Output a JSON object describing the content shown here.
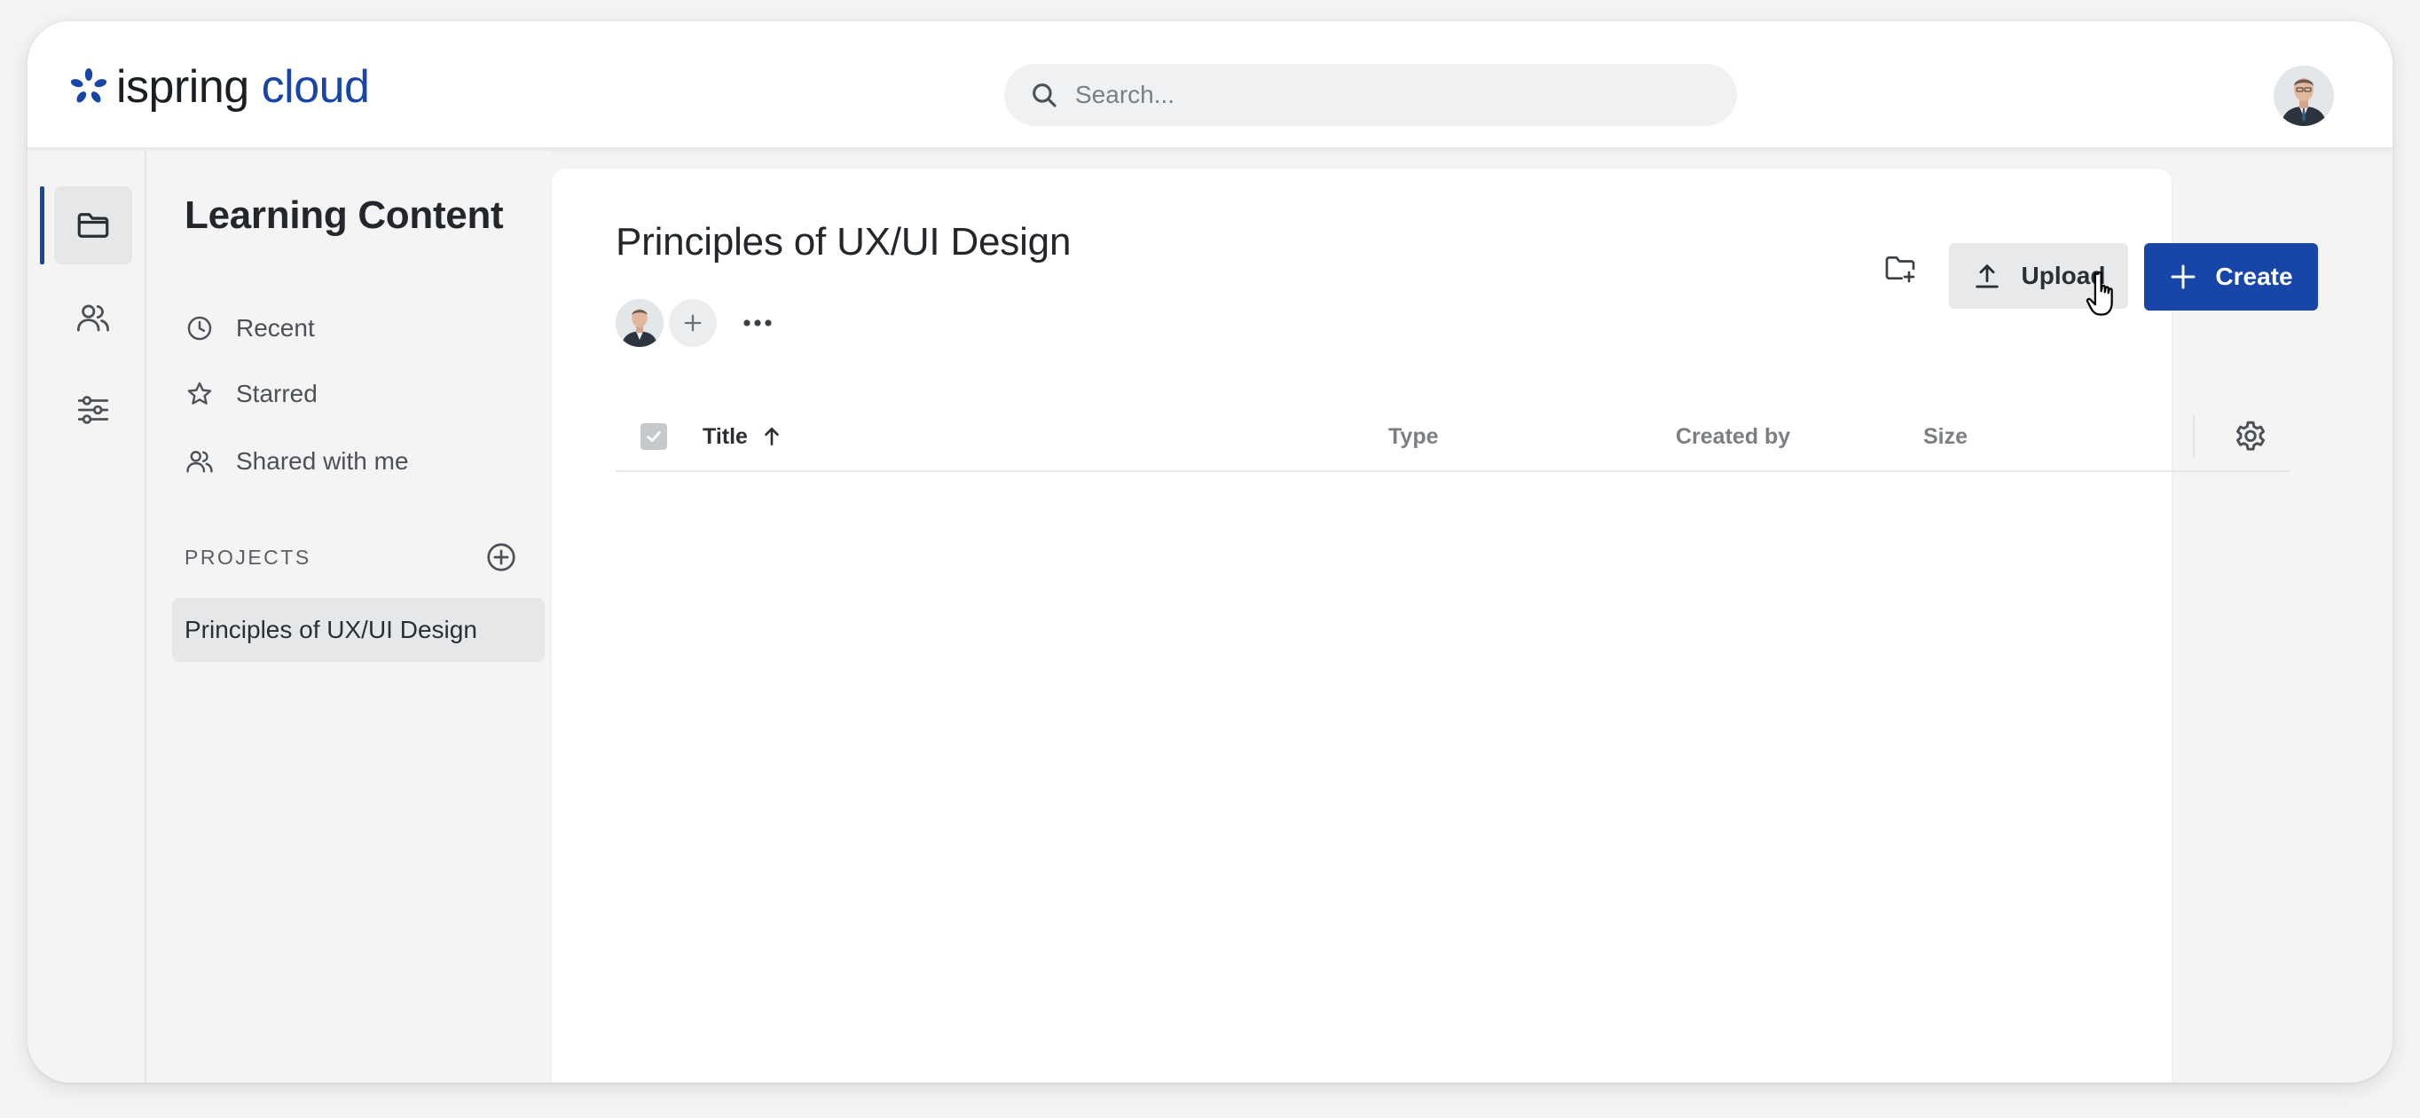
{
  "header": {
    "logo_word_1": "ispring",
    "logo_word_2": "cloud",
    "search_placeholder": "Search..."
  },
  "rail": {
    "items": [
      {
        "icon": "folder-icon",
        "active": true
      },
      {
        "icon": "users-icon",
        "active": false
      },
      {
        "icon": "sliders-icon",
        "active": false
      }
    ]
  },
  "nav": {
    "title": "Learning Content",
    "links": [
      {
        "label": "Recent",
        "icon": "clock-icon"
      },
      {
        "label": "Starred",
        "icon": "star-icon"
      },
      {
        "label": "Shared with me",
        "icon": "users-icon"
      }
    ],
    "projects_label": "PROJECTS",
    "projects": [
      {
        "label": "Principles of UX/UI Design",
        "selected": true
      }
    ]
  },
  "main": {
    "title": "Principles of UX/UI Design",
    "upload_label": "Upload",
    "create_label": "Create",
    "table": {
      "columns": [
        "Title",
        "Type",
        "Created by",
        "Size"
      ],
      "sort_column": "Title",
      "sort_direction": "ascending",
      "rows": []
    }
  },
  "colors": {
    "accent": "#1846a8",
    "background": "#f4f4f4",
    "surface": "#ffffff"
  }
}
